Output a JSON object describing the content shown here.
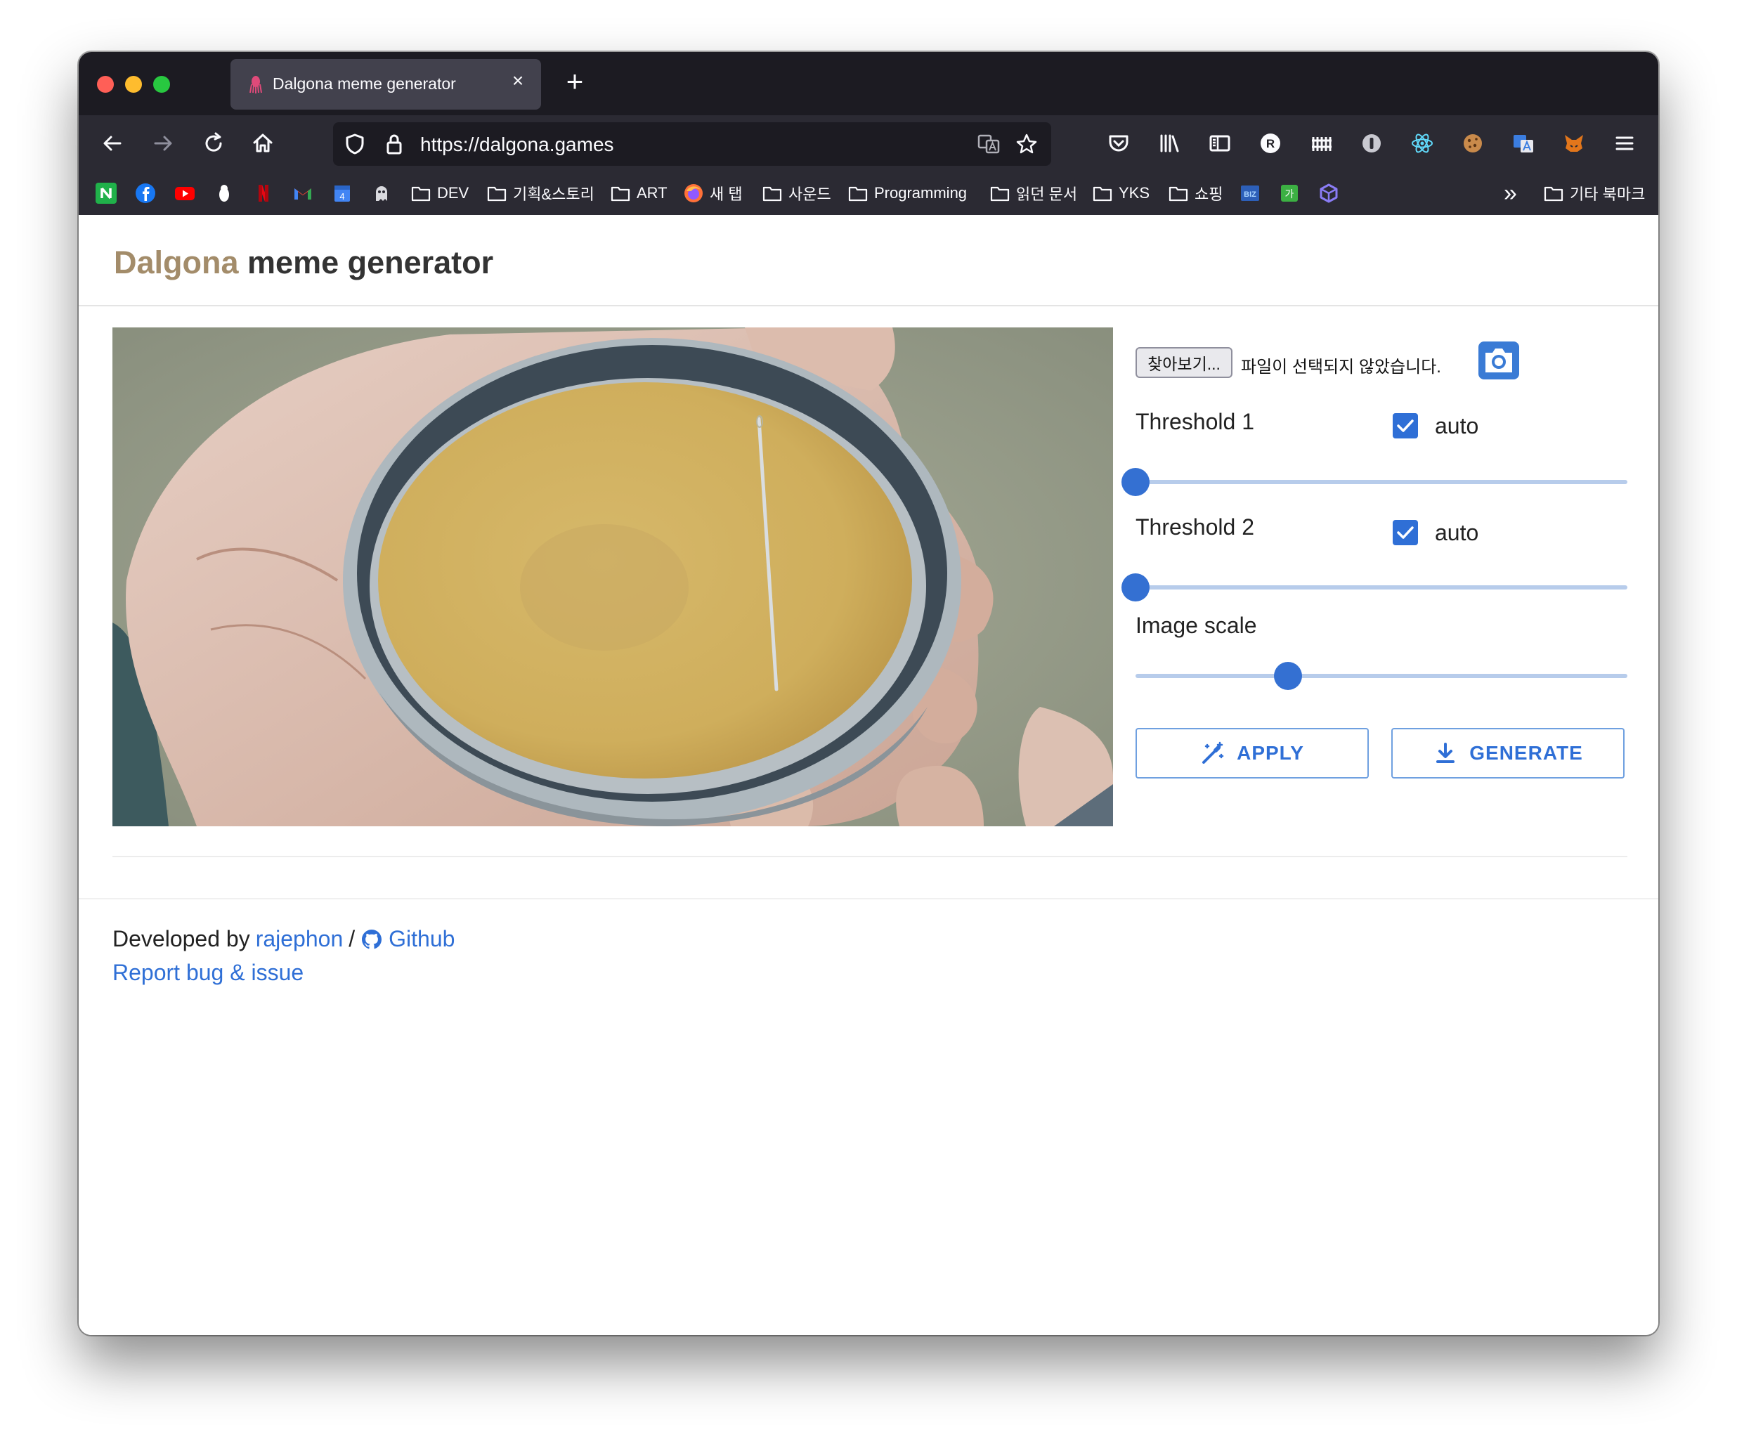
{
  "browser": {
    "tab_title": "Dalgona meme generator",
    "url": "https://dalgona.games",
    "bookmarks": [
      {
        "label": "DEV"
      },
      {
        "label": "기획&스토리"
      },
      {
        "label": "ART"
      },
      {
        "label": "새 탭"
      },
      {
        "label": "사운드"
      },
      {
        "label": "Programming"
      },
      {
        "label": "읽던 문서"
      },
      {
        "label": "YKS"
      },
      {
        "label": "쇼핑"
      },
      {
        "label": "기타 북마크"
      }
    ],
    "icon_labels": {
      "close": "×",
      "new_tab": "+",
      "overflow": "»",
      "cal_day": "4",
      "biz": "BIZ",
      "ga": "가",
      "r_ext": "R"
    }
  },
  "page": {
    "title_accent": "Dalgona",
    "title_rest": " meme generator",
    "file_button": "찾아보기...",
    "file_status": "파일이 선택되지 않았습니다.",
    "threshold1": {
      "label": "Threshold 1",
      "auto_label": "auto",
      "auto_checked": true,
      "value_fraction": 0.0
    },
    "threshold2": {
      "label": "Threshold 2",
      "auto_label": "auto",
      "auto_checked": true,
      "value_fraction": 0.0
    },
    "image_scale": {
      "label": "Image scale",
      "value_fraction": 0.31
    },
    "apply_label": "APPLY",
    "generate_label": "GENERATE",
    "footer": {
      "developed_by": "Developed by",
      "author": "rajephon",
      "separator": "/",
      "github": "Github",
      "report": "Report bug & issue"
    }
  },
  "colors": {
    "accent": "#a38c6a",
    "primary": "#2f6fd6",
    "chrome_dark": "#1c1b22",
    "chrome": "#2b2a33"
  }
}
